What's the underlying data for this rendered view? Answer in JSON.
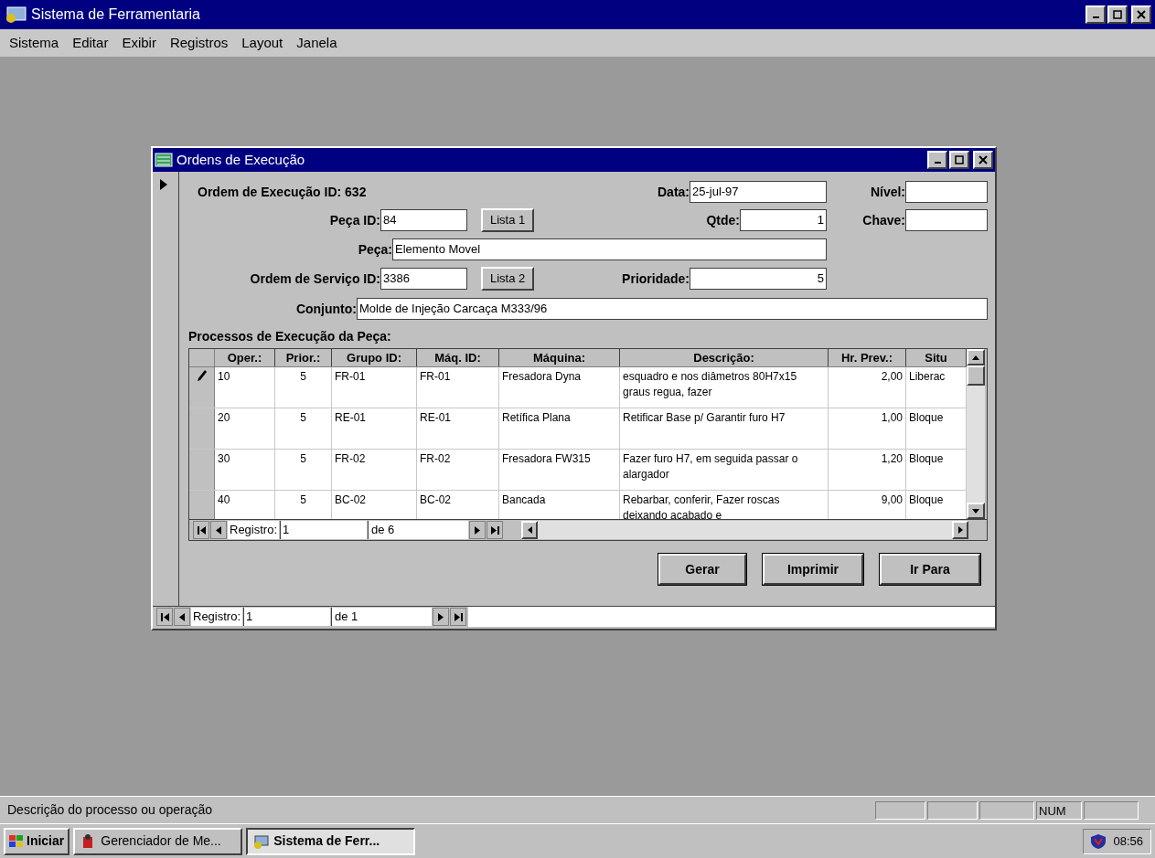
{
  "window": {
    "title": "Sistema de Ferramentaria"
  },
  "menu": [
    "Sistema",
    "Editar",
    "Exibir",
    "Registros",
    "Layout",
    "Janela"
  ],
  "form": {
    "title": "Ordens de Execução",
    "order_label": "Ordem de Execução ID: 632",
    "fields": [
      {
        "label": "Data:",
        "value": "25-jul-97",
        "kind": "text"
      },
      {
        "label": "Nível:",
        "kind": "text"
      },
      {
        "label": "Peça ID:",
        "value": "84",
        "kind": "text"
      },
      {
        "label": "Qtde:",
        "value": "1",
        "kind": "number"
      },
      {
        "label": "Chave:",
        "kind": "text"
      },
      {
        "label": "Peça:",
        "value": "Elemento Movel",
        "kind": "text"
      },
      {
        "label": "Ordem de Serviço ID:",
        "value": "3386",
        "kind": "text"
      },
      {
        "label": "Prioridade:",
        "value": "5",
        "kind": "number"
      },
      {
        "label": "Conjunto:",
        "value": "Molde de Injeção Carcaça M333/96",
        "kind": "text"
      }
    ],
    "list_buttons": [
      "Lista 1",
      "Lista 2"
    ],
    "subform_title": "Processos de Execução da Peça:",
    "table": {
      "columns": [
        "Oper.:",
        "Prior.:",
        "Grupo ID:",
        "Máq. ID:",
        "Máquina:",
        "Descrição:",
        "Hr. Prev.:",
        "Situ"
      ],
      "rows": [
        {
          "editing": true,
          "cells": [
            "10",
            "5",
            "FR-01",
            "FR-01",
            "Fresadora Dyna",
            "esquadro e nos diâmetros 80H7x15 graus regua, fazer",
            "2,00",
            "Liberac"
          ]
        },
        {
          "editing": false,
          "cells": [
            "20",
            "5",
            "RE-01",
            "RE-01",
            "Retífica Plana",
            "Retificar Base p/ Garantir furo H7",
            "1,00",
            "Bloque"
          ]
        },
        {
          "editing": false,
          "cells": [
            "30",
            "5",
            "FR-02",
            "FR-02",
            "Fresadora FW315",
            "Fazer furo H7, em seguida passar o alargador",
            "1,20",
            "Bloque"
          ]
        },
        {
          "editing": false,
          "cells": [
            "40",
            "5",
            "BC-02",
            "BC-02",
            "Bancada",
            "Rebarbar, conferir, Fazer roscas deixando acabado e",
            "9,00",
            "Bloque"
          ]
        }
      ]
    },
    "sub_nav": {
      "label": "Registro:",
      "value": "1",
      "total": "de 6"
    },
    "buttons": [
      "Gerar",
      "Imprimir",
      "Ir Para"
    ],
    "nav": {
      "label": "Registro:",
      "value": "1",
      "total": "de 1"
    }
  },
  "status_bar": {
    "text": "Descrição do processo ou operação",
    "indicator": "NUM"
  },
  "taskbar": {
    "start": "Iniciar",
    "tasks": [
      {
        "label": "Gerenciador de Me...",
        "selected": false
      },
      {
        "label": "Sistema de Ferr...",
        "selected": true
      }
    ],
    "clock": "08:56"
  }
}
